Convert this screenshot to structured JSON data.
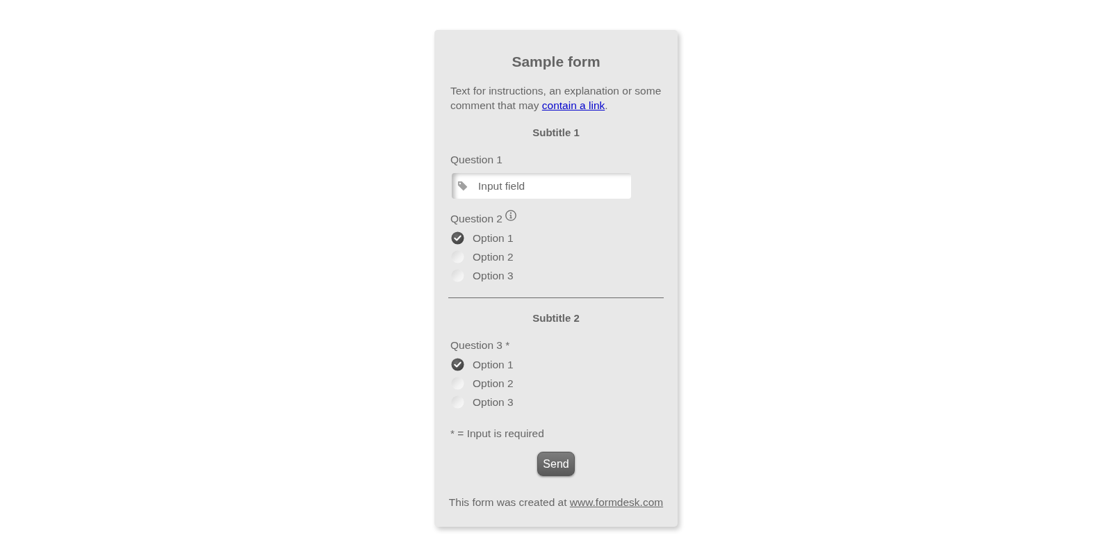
{
  "form": {
    "title": "Sample form",
    "intro": {
      "text": "Text for instructions, an explanation or some comment that may ",
      "link": "contain a link",
      "after": "."
    },
    "sections": [
      {
        "subtitle": "Subtitle 1",
        "questions": [
          {
            "kind": "text",
            "label": "Question 1",
            "info": false,
            "placeholder": "Input field"
          },
          {
            "kind": "radio",
            "label": "Question 2",
            "info": true,
            "options": [
              {
                "label": "Option 1",
                "selected": true
              },
              {
                "label": "Option 2",
                "selected": false
              },
              {
                "label": "Option 3",
                "selected": false
              }
            ]
          }
        ]
      },
      {
        "subtitle": "Subtitle 2",
        "questions": [
          {
            "kind": "radio",
            "label": "Question 3 *",
            "info": false,
            "options": [
              {
                "label": "Option 1",
                "selected": true
              },
              {
                "label": "Option 2",
                "selected": false
              },
              {
                "label": "Option 3",
                "selected": false
              }
            ]
          }
        ]
      }
    ],
    "required_note": "* = Input is required",
    "submit_button": "Send",
    "footer": {
      "text": "This form was created at ",
      "link": "www.formdesk.com"
    }
  }
}
